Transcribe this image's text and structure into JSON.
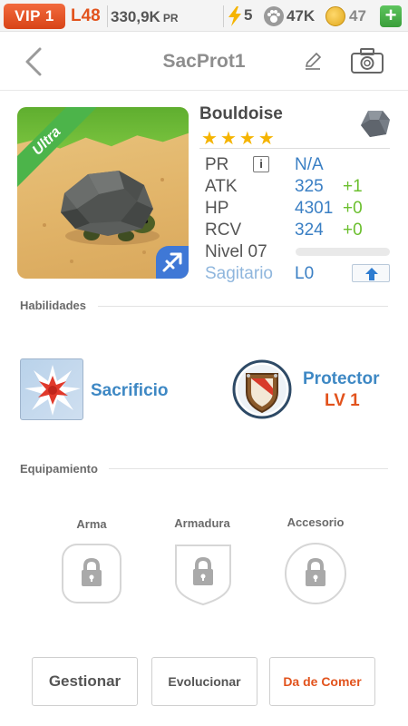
{
  "topbar": {
    "vip": "VIP 1",
    "level": "L48",
    "pr": "330,9K",
    "pr_unit": "PR",
    "energy": "5",
    "paws": "47K",
    "coins": "47",
    "plus": "+"
  },
  "header": {
    "title": "SacProt1"
  },
  "monster": {
    "name": "Bouldoise",
    "stars": 4,
    "rarity": "Ultra",
    "stats": [
      {
        "label": "PR",
        "value": "N/A",
        "bonus": ""
      },
      {
        "label": "ATK",
        "value": "325",
        "bonus": "+1"
      },
      {
        "label": "HP",
        "value": "4301",
        "bonus": "+0"
      },
      {
        "label": "RCV",
        "value": "324",
        "bonus": "+0"
      }
    ],
    "info_glyph": "i",
    "level_label": "Nivel 07",
    "xp_fraction": 0,
    "sign_label": "Sagitario",
    "sign_level": "L0"
  },
  "skills": {
    "section_title": "Habilidades",
    "skill1": {
      "name": "Sacrificio"
    },
    "skill2": {
      "name": "Protector",
      "level": "LV 1"
    }
  },
  "equipment": {
    "section_title": "Equipamiento",
    "slots": [
      {
        "label": "Arma"
      },
      {
        "label": "Armadura"
      },
      {
        "label": "Accesorio"
      }
    ]
  },
  "actions": {
    "manage": "Gestionar",
    "evolve": "Evolucionar",
    "feed": "Da de Comer"
  },
  "colors": {
    "accent_orange": "#e2531d",
    "accent_blue": "#3e88c4",
    "bonus_green": "#6bbf2e",
    "star_gold": "#f5b400"
  }
}
